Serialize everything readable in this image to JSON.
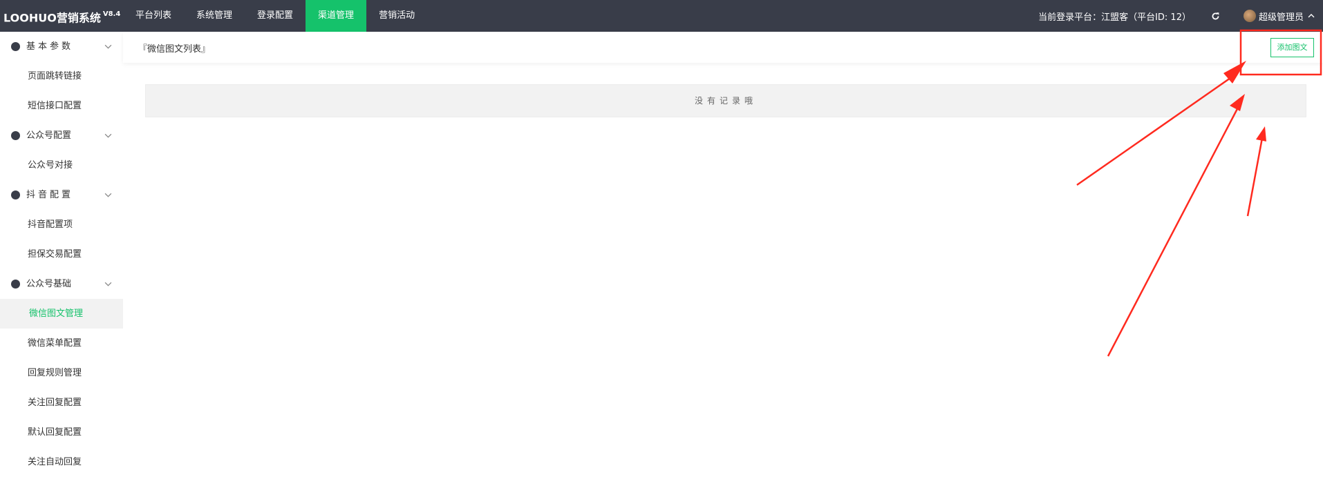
{
  "app": {
    "title": "LOOHUO营销系统",
    "version": "V8.4"
  },
  "topnav": {
    "items": [
      {
        "label": "平台列表"
      },
      {
        "label": "系统管理"
      },
      {
        "label": "登录配置"
      },
      {
        "label": "渠道管理",
        "active": true
      },
      {
        "label": "营销活动"
      }
    ]
  },
  "header": {
    "platform_text": "当前登录平台：江盟客（平台ID: 12）",
    "refresh_icon": "refresh-icon",
    "user_name": "超级管理员"
  },
  "sidebar": {
    "groups": [
      {
        "label": "基本参数",
        "icon": "compass-icon",
        "items": [
          {
            "label": "页面跳转链接"
          },
          {
            "label": "短信接口配置"
          }
        ]
      },
      {
        "label": "公众号配置",
        "icon": "wechat-icon",
        "items": [
          {
            "label": "公众号对接"
          }
        ]
      },
      {
        "label": "抖音配置",
        "icon": "play-icon",
        "items": [
          {
            "label": "抖音配置项"
          },
          {
            "label": "担保交易配置"
          }
        ]
      },
      {
        "label": "公众号基础",
        "icon": "location-icon",
        "items": [
          {
            "label": "微信图文管理",
            "active": true
          },
          {
            "label": "微信菜单配置"
          },
          {
            "label": "回复规则管理"
          },
          {
            "label": "关注回复配置"
          },
          {
            "label": "默认回复配置"
          },
          {
            "label": "关注自动回复"
          }
        ]
      }
    ]
  },
  "main": {
    "breadcrumb": "『微信图文列表』",
    "add_button": "添加图文",
    "empty_text": "没有记录哦"
  },
  "colors": {
    "topbar": "#393d49",
    "accent": "#15c26b",
    "annotation": "#ff2a1f"
  }
}
